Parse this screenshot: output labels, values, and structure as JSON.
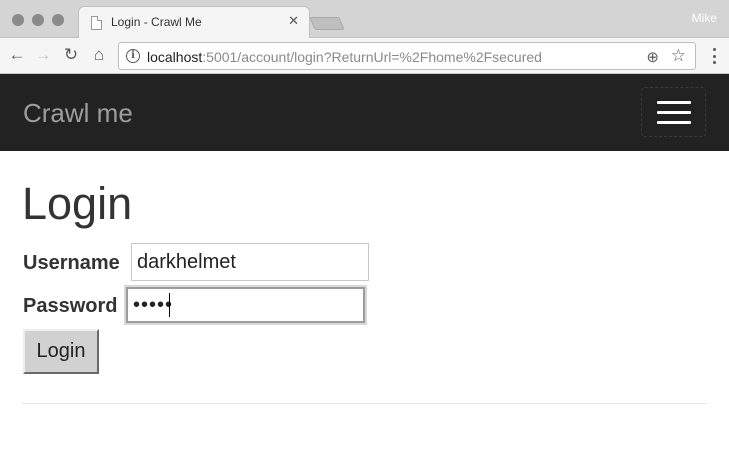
{
  "browser": {
    "tab_title": "Login - Crawl Me",
    "tab_close": "✕",
    "profile_name": "Mike",
    "url_host": "localhost",
    "url_rest": ":5001/account/login?ReturnUrl=%2Fhome%2Fsecured",
    "icons": {
      "back": "←",
      "forward": "→",
      "reload": "↻",
      "home": "⌂",
      "info": "i",
      "zoom": "⊕",
      "star": "☆"
    }
  },
  "navbar": {
    "brand": "Crawl me",
    "background": "#222222"
  },
  "page": {
    "title": "Login",
    "username_label": "Username",
    "username_value": "darkhelmet",
    "password_label": "Password",
    "password_value": "•••••",
    "submit_label": "Login"
  }
}
